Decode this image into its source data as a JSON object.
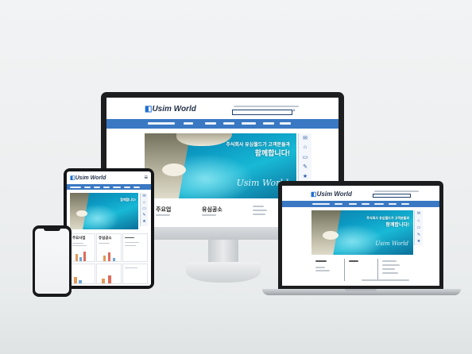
{
  "site": {
    "logo_text": "Usim World",
    "hero_headline_1": "주식회사 유심월드가 고객분들과",
    "hero_headline_2": "함께합니다!",
    "hero_script": "Usim World",
    "section_1": "주요업",
    "section_2": "유심공소",
    "tablet_section_1": "주요사업",
    "tablet_section_2": "유심공소"
  },
  "colors": {
    "nav": "#3a78c3",
    "logo_mark": "#1f6fd1",
    "hero_sea": "#18b9d6"
  },
  "icons": {
    "quick_menu": [
      "chat-icon",
      "map-icon",
      "monitor-icon",
      "pencil-icon",
      "star-icon"
    ]
  }
}
